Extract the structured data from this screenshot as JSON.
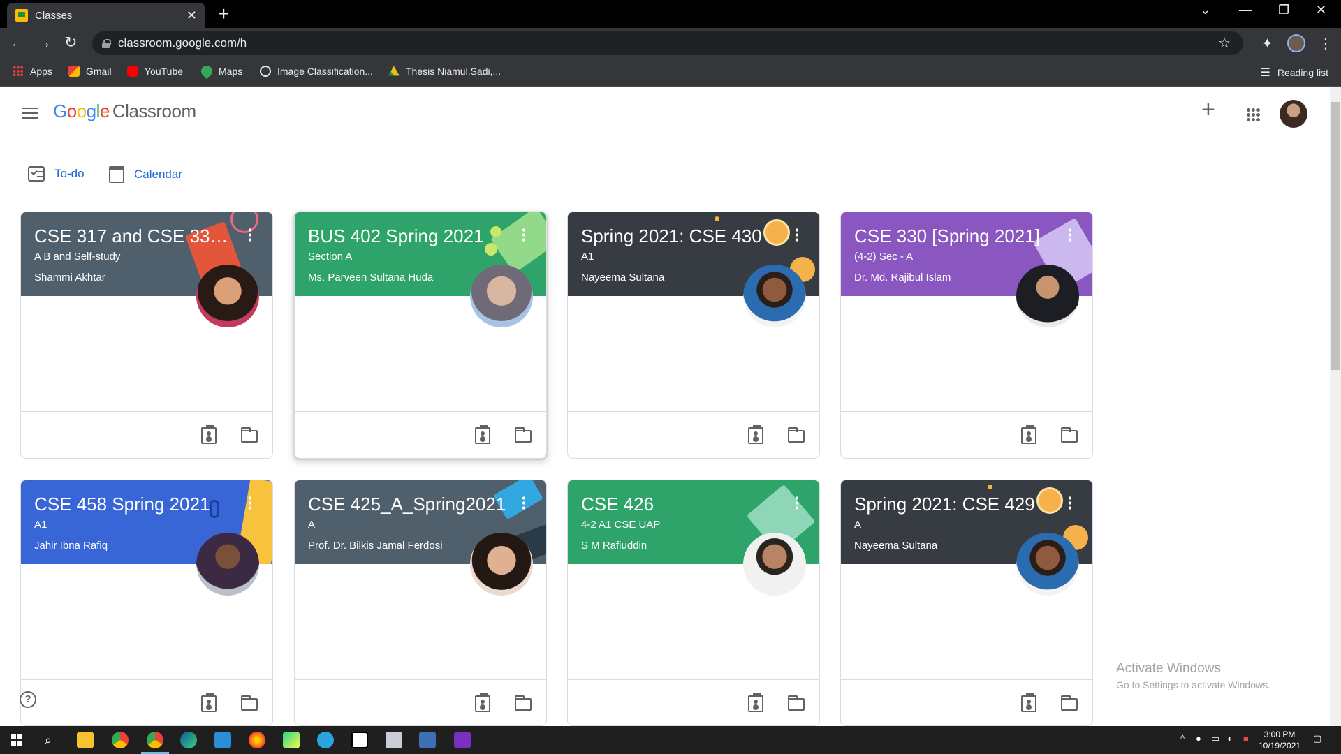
{
  "browser": {
    "tab_title": "Classes",
    "url": "classroom.google.com/h",
    "bookmarks": [
      {
        "label": "Apps",
        "icon": "apps-grid-icon"
      },
      {
        "label": "Gmail",
        "icon": "gmail-icon"
      },
      {
        "label": "YouTube",
        "icon": "youtube-icon"
      },
      {
        "label": "Maps",
        "icon": "maps-icon"
      },
      {
        "label": "Image Classification...",
        "icon": "globe-icon"
      },
      {
        "label": "Thesis Niamul,Sadi,...",
        "icon": "drive-icon"
      }
    ],
    "reading_list": "Reading list"
  },
  "header": {
    "logo_letters": [
      "G",
      "o",
      "o",
      "g",
      "l",
      "e"
    ],
    "product": "Classroom"
  },
  "subnav": {
    "todo": "To-do",
    "calendar": "Calendar"
  },
  "classes": [
    {
      "title": "CSE 317 and CSE 331(...",
      "section": "A B and Self-study",
      "teacher": "Shammi Akhtar",
      "color": "#4f5f6c"
    },
    {
      "title": "BUS 402 Spring 2021",
      "section": "Section A",
      "teacher": "Ms. Parveen Sultana Huda",
      "color": "#2fa46a"
    },
    {
      "title": "Spring 2021: CSE 430",
      "section": "A1",
      "teacher": "Nayeema Sultana",
      "color": "#363c41"
    },
    {
      "title": "CSE 330 [Spring 2021]",
      "section": "(4-2) Sec - A",
      "teacher": "Dr. Md. Rajibul Islam",
      "color": "#8a56c0"
    },
    {
      "title": "CSE 458 Spring 2021",
      "section": "A1",
      "teacher": "Jahir Ibna Rafiq",
      "color": "#3966d6"
    },
    {
      "title": "CSE 425_A_Spring2021",
      "section": "A",
      "teacher": "Prof. Dr. Bilkis Jamal Ferdosi",
      "color": "#4f5f6c"
    },
    {
      "title": "CSE 426",
      "section": "4-2 A1 CSE UAP",
      "teacher": "S M Rafiuddin",
      "color": "#2fa46a"
    },
    {
      "title": "Spring 2021: CSE 429",
      "section": "A",
      "teacher": "Nayeema Sultana",
      "color": "#363c41"
    }
  ],
  "watermark": {
    "title": "Activate Windows",
    "subtitle": "Go to Settings to activate Windows."
  },
  "taskbar": {
    "time": "3:00 PM",
    "date": "10/19/2021"
  }
}
